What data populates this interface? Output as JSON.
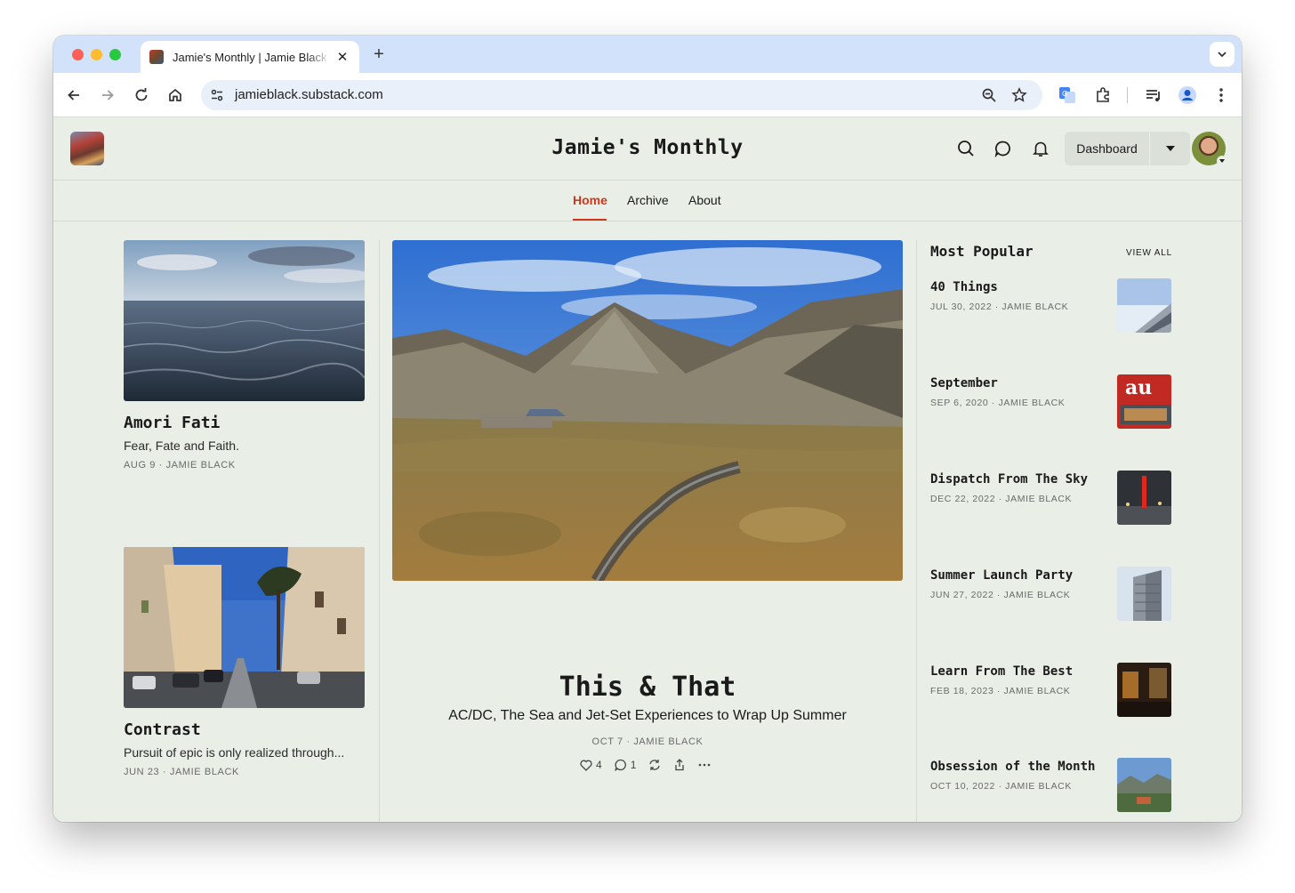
{
  "browser": {
    "tab_title": "Jamie's Monthly | Jamie Black",
    "url": "jamieblack.substack.com"
  },
  "site": {
    "title": "Jamie's Monthly",
    "dashboard_label": "Dashboard",
    "nav": [
      "Home",
      "Archive",
      "About"
    ],
    "accent_color": "#d1361d",
    "background_color": "#e9efe6"
  },
  "left_posts": [
    {
      "title": "Amori Fati",
      "subtitle": "Fear, Fate and Faith.",
      "meta": "AUG 9 · JAMIE BLACK"
    },
    {
      "title": "Contrast",
      "subtitle": "Pursuit of epic is only realized through...",
      "meta": "JUN 23 · JAMIE BLACK"
    }
  ],
  "featured": {
    "title": "This & That",
    "subtitle": "AC/DC, The Sea and Jet-Set Experiences to Wrap Up Summer",
    "meta": "OCT 7 · JAMIE BLACK",
    "likes": "4",
    "comments": "1"
  },
  "most_popular": {
    "heading": "Most Popular",
    "view_all": "VIEW ALL",
    "items": [
      {
        "title": "40 Things",
        "meta": "JUL 30, 2022 · JAMIE BLACK"
      },
      {
        "title": "September",
        "meta": "SEP 6, 2020 · JAMIE BLACK"
      },
      {
        "title": "Dispatch From The Sky",
        "meta": "DEC 22, 2022 · JAMIE BLACK"
      },
      {
        "title": "Summer Launch Party",
        "meta": "JUN 27, 2022 · JAMIE BLACK"
      },
      {
        "title": "Learn From The Best",
        "meta": "FEB 18, 2023 · JAMIE BLACK"
      },
      {
        "title": "Obsession of the Month",
        "meta": "OCT 10, 2022 · JAMIE BLACK"
      }
    ]
  },
  "icons": [
    "back-icon",
    "forward-icon",
    "reload-icon",
    "home-icon",
    "site-settings-icon",
    "zoom-icon",
    "bookmark-star-icon",
    "translate-icon",
    "extensions-icon",
    "reading-list-icon",
    "profile-icon",
    "kebab-menu-icon",
    "search-icon",
    "chat-icon",
    "bell-icon",
    "heart-icon",
    "comment-icon",
    "restack-icon",
    "share-icon",
    "more-icon"
  ]
}
